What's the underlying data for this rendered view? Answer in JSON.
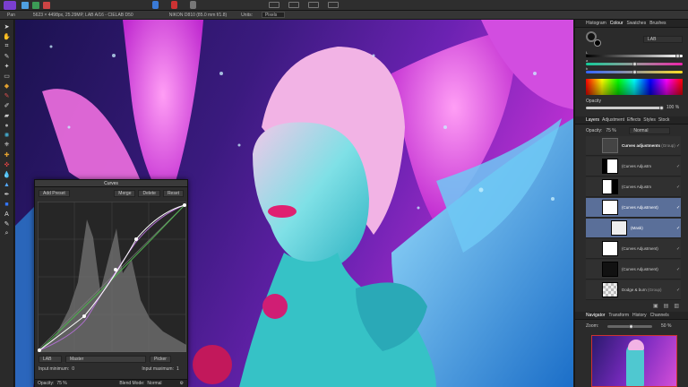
{
  "context": {
    "tool": "Pan",
    "doc_info": "5623 × 4498px, 25.29MP, LAB A/16 - CIELAB D50",
    "camera": "NIKON D810 (85.0 mm f/1.8)",
    "units_label": "Units:",
    "units_value": "Pixels"
  },
  "right_panel": {
    "top_tabs": [
      "Histogram",
      "Colour",
      "Swatches",
      "Brushes"
    ],
    "active_top_tab": "Colour",
    "colour_mode": "LAB",
    "slider_labels": [
      "L",
      "a",
      "b"
    ],
    "opacity_label": "Opacity",
    "opacity_value": "100 %",
    "layer_tabs": [
      "Layers",
      "Adjustment",
      "Effects",
      "Styles",
      "Stock"
    ],
    "layers_opacity_label": "Opacity:",
    "layers_opacity_value": "75 %",
    "blend_mode": "Normal",
    "layers": [
      {
        "name": "Curves adjustments",
        "suffix": "(Group)",
        "selected": false
      },
      {
        "name": "(Curves Adjustm",
        "suffix": "",
        "selected": false
      },
      {
        "name": "(Curves Adjustm",
        "suffix": "",
        "selected": false
      },
      {
        "name": "(Curves Adjustment)",
        "suffix": "",
        "selected": true
      },
      {
        "name": "(Mask)",
        "suffix": "",
        "selected": true
      },
      {
        "name": "(Curves Adjustment)",
        "suffix": "",
        "selected": false
      },
      {
        "name": "(Curves Adjustment)",
        "suffix": "",
        "selected": false
      },
      {
        "name": "Dodge & burn",
        "suffix": "(Group)",
        "selected": false
      }
    ],
    "nav_tabs": [
      "Navigator",
      "Transform",
      "History",
      "Channels"
    ],
    "zoom_label": "Zoom:",
    "zoom_value": "50 %"
  },
  "curves": {
    "title": "Curves",
    "add_preset": "Add Preset",
    "merge": "Merge",
    "delete": "Delete",
    "reset": "Reset",
    "channel_space": "LAB",
    "channel": "Master",
    "picker": "Picker",
    "input_min_label": "Input minimum:",
    "input_min_value": "0",
    "input_max_label": "Input maximum:",
    "input_max_value": "1",
    "opacity_label": "Opacity:",
    "opacity_value": "75 %",
    "blend_label": "Blend Mode:",
    "blend_value": "Normal"
  },
  "colors": {
    "selected_layer": "#5a6f99",
    "panel_bg": "#2b2b2b",
    "accent_blue": "#2e6bd8"
  }
}
